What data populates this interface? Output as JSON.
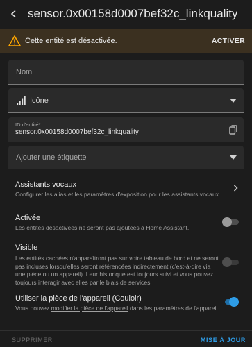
{
  "header": {
    "title": "sensor.0x00158d0007bef32c_linkquality"
  },
  "warning": {
    "text": "Cette entité est désactivée.",
    "action_label": "ACTIVER"
  },
  "form": {
    "name_label": "Nom",
    "icon_label": "Icône",
    "entity_id_label": "ID d'entité*",
    "entity_id_value": "sensor.0x00158d0007bef32c_linkquality",
    "tag_label": "Ajouter une étiquette"
  },
  "voice": {
    "title": "Assistants vocaux",
    "description": "Configurer les alias et les paramètres d'exposition pour les assistants vocaux"
  },
  "enabled": {
    "title": "Activée",
    "description": "Les entités désactivées ne seront pas ajoutées à Home Assistant.",
    "on": false
  },
  "visible": {
    "title": "Visible",
    "description_line1": "Les entités cachées n'apparaîtront pas sur votre tableau de bord et ne seront",
    "description_line2": "pas incluses lorsqu'elles seront référencées indirectement (c'est-à-dire via",
    "description_line3": "une pièce ou un appareil). Leur historique est toujours suivi et vous pouvez",
    "description_line4": "toujours interagir avec elles par le biais de services.",
    "on": false
  },
  "area": {
    "title": "Utiliser la pièce de l'appareil (Couloir)",
    "desc_before": "Vous pouvez ",
    "desc_link": "modifier la pièce de l'appareil",
    "desc_after": " dans les paramètres de l'appareil",
    "on": true
  },
  "footer": {
    "delete_label": "SUPPRIMER",
    "update_label": "MISE À JOUR"
  },
  "colors": {
    "background": "#1c1c1c",
    "field": "#2a2a2a",
    "warning_bg": "#3b3020",
    "warning_icon": "#ffa600",
    "accent": "#2e9ce6"
  }
}
